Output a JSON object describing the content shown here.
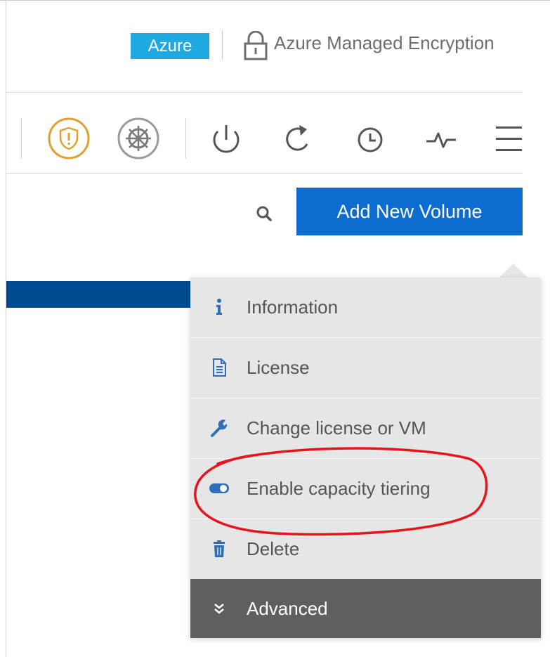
{
  "header": {
    "cloud_badge": "Azure",
    "encryption_label": "Azure Managed Encryption"
  },
  "toolbar": {
    "icons": [
      "shield-warning-icon",
      "kubernetes-wheel-icon",
      "power-icon",
      "refresh-icon",
      "clock-icon",
      "activity-pulse-icon",
      "hamburger-menu-icon"
    ],
    "warning_color": "#e0a030"
  },
  "actions": {
    "add_volume_label": "Add New Volume"
  },
  "menu": {
    "items": [
      {
        "label": "Information",
        "icon": "info-icon"
      },
      {
        "label": "License",
        "icon": "document-icon"
      },
      {
        "label": "Change license or VM",
        "icon": "wrench-icon"
      },
      {
        "label": "Enable capacity tiering",
        "icon": "toggle-icon"
      },
      {
        "label": "Delete",
        "icon": "trash-icon"
      },
      {
        "label": "Advanced",
        "icon": "double-chevron-down-icon"
      }
    ]
  },
  "colors": {
    "azure_badge": "#1fa9e0",
    "primary_button": "#0d6ccf",
    "selected_row": "#004a91",
    "menu_bg": "#e6e6e6",
    "menu_advanced_bg": "#5f5f5f",
    "menu_icon": "#2e6fb5",
    "annotation": "#e8141c"
  }
}
